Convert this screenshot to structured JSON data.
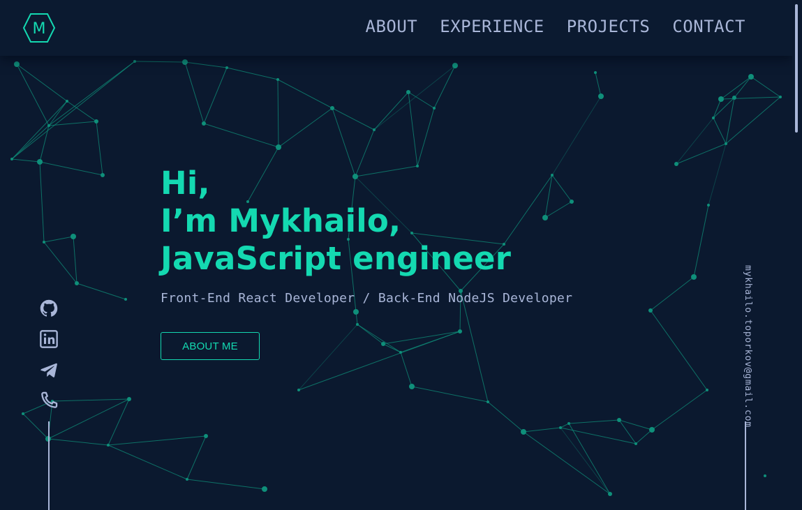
{
  "header": {
    "logo_letter": "M",
    "nav": [
      {
        "label": "ABOUT"
      },
      {
        "label": "EXPERIENCE"
      },
      {
        "label": "PROJECTS"
      },
      {
        "label": "CONTACT"
      }
    ]
  },
  "hero": {
    "greeting_line1": "Hi,",
    "greeting_line2": "I’m Mykhailo,",
    "greeting_line3": "JavaScript engineer",
    "subtitle": "Front-End React Developer / Back-End NodeJS Developer",
    "cta_label": "ABOUT ME"
  },
  "social": {
    "icons": [
      "github-icon",
      "linkedin-icon",
      "telegram-icon",
      "phone-icon"
    ]
  },
  "contact": {
    "email": "mykhailo.toporkov@gmail.com"
  },
  "colors": {
    "background": "#0b192f",
    "accent": "#14d9b1",
    "text": "#a9b6d8",
    "network_line": "#0f8f7a"
  }
}
